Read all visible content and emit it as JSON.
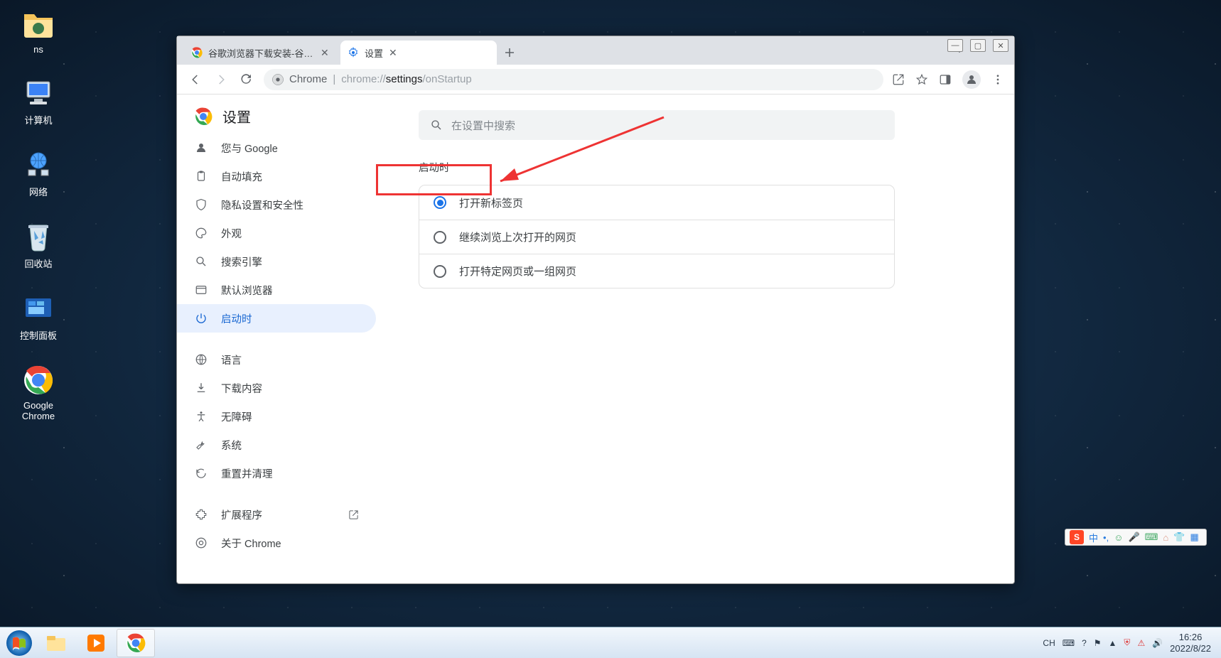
{
  "desktop": {
    "icons": [
      {
        "label": "ns"
      },
      {
        "label": "计算机"
      },
      {
        "label": "网络"
      },
      {
        "label": "回收站"
      },
      {
        "label": "控制面板"
      },
      {
        "label": "Google Chrome"
      }
    ]
  },
  "chrome": {
    "tabs": [
      {
        "title": "谷歌浏览器下载安装-谷歌浏览器",
        "active": false
      },
      {
        "title": "设置",
        "active": true
      }
    ],
    "address": {
      "product": "Chrome",
      "prefix": "chrome://",
      "path1": "settings",
      "path2": "/onStartup"
    },
    "settings_title": "设置",
    "search_placeholder": "在设置中搜索",
    "sidebar": [
      {
        "label": "您与 Google"
      },
      {
        "label": "自动填充"
      },
      {
        "label": "隐私设置和安全性"
      },
      {
        "label": "外观"
      },
      {
        "label": "搜索引擎"
      },
      {
        "label": "默认浏览器"
      },
      {
        "label": "启动时",
        "active": true
      },
      {
        "label": "语言"
      },
      {
        "label": "下载内容"
      },
      {
        "label": "无障碍"
      },
      {
        "label": "系统"
      },
      {
        "label": "重置并清理"
      },
      {
        "label": "扩展程序",
        "external": true
      },
      {
        "label": "关于 Chrome"
      }
    ],
    "section_title": "启动时",
    "options": [
      {
        "label": "打开新标签页",
        "selected": true
      },
      {
        "label": "继续浏览上次打开的网页",
        "selected": false
      },
      {
        "label": "打开特定网页或一组网页",
        "selected": false
      }
    ]
  },
  "taskbar": {
    "tray_lang": "CH",
    "time": "16:26",
    "date": "2022/8/22"
  },
  "ime": {
    "label": "中"
  }
}
